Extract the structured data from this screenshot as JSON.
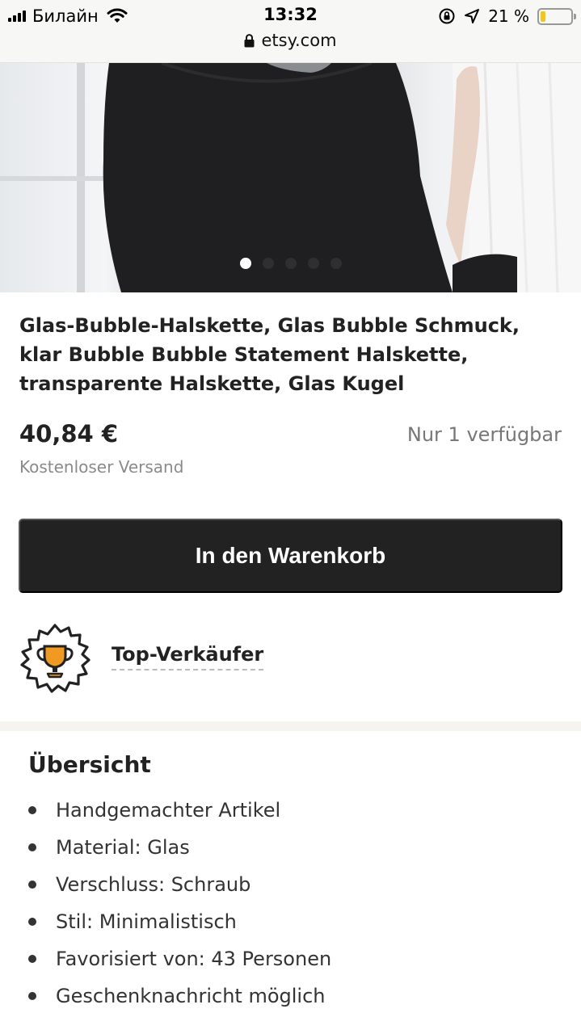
{
  "status_bar": {
    "carrier": "Билайн",
    "time": "13:32",
    "battery_percent_label": "21 %",
    "battery_level": 0.21,
    "url": "etsy.com",
    "icons": [
      "signal-icon",
      "wifi-icon",
      "rotation-lock-icon",
      "location-icon",
      "battery-icon",
      "lock-icon"
    ]
  },
  "gallery": {
    "image_count": 5,
    "active_index": 0
  },
  "product": {
    "title": "Glas-Bubble-Halskette, Glas Bubble Schmuck, klar Bubble Bubble Statement Halskette, transparente Halskette, Glas Kugel",
    "price": "40,84 €",
    "availability": "Nur 1 verfügbar",
    "shipping": "Kostenloser Versand",
    "cart_button_label": "In den Warenkorb"
  },
  "seller_badge": {
    "label": "Top-Verkäufer",
    "icon": "trophy-icon"
  },
  "overview": {
    "heading": "Übersicht",
    "items": [
      "Handgemachter Artikel",
      "Material: Glas",
      "Verschluss: Schraub",
      "Stil: Minimalistisch",
      "Favorisiert von: 43 Personen",
      "Geschenknachricht möglich"
    ]
  },
  "colors": {
    "button_bg": "#222222",
    "badge_orange": "#f19a22",
    "battery_yellow": "#f5c518"
  }
}
